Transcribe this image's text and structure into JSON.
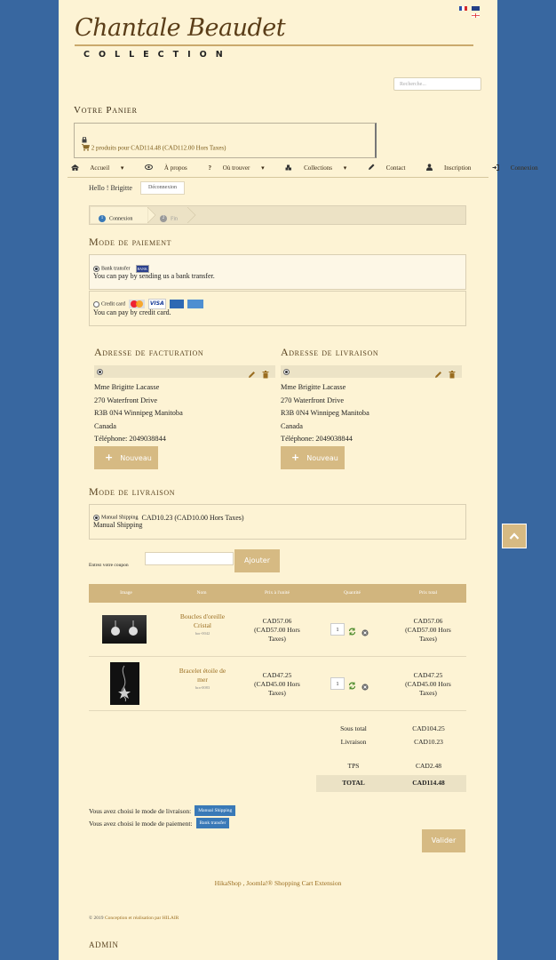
{
  "header": {
    "logo_main": "Chantale Beaudet",
    "logo_sub": "COLLECTION",
    "search_placeholder": "Recherche..."
  },
  "cart": {
    "title": "Votre Panier",
    "summary_prefix": "2 produits pour ",
    "summary_value": "CAD114.48 (CAD112.00 Hors Taxes)"
  },
  "nav": {
    "items": [
      "Accueil",
      "À propos",
      "Où trouver",
      "Collections",
      "Contact",
      "Inscription",
      "Connexion"
    ]
  },
  "user": {
    "hello": "Hello ! Brigitte",
    "logout": "Déconnexion"
  },
  "steps": [
    {
      "num": "1",
      "label": "Connexion"
    },
    {
      "num": "2",
      "label": "Fin"
    }
  ],
  "payment": {
    "title": "Mode de paiement",
    "options": [
      {
        "label": "Bank transfer",
        "badge": "BANK",
        "desc": "You can pay by sending us a bank transfer.",
        "selected": true
      },
      {
        "label": "Credit card",
        "desc": "You can pay by credit card.",
        "selected": false
      }
    ]
  },
  "billing": {
    "title": "Adresse de facturation",
    "name": "Mme Brigitte Lacasse",
    "street": "270 Waterfront Drive",
    "city": "R3B 0N4 Winnipeg Manitoba",
    "country": "Canada",
    "phone": "Téléphone: 2049038844",
    "new_button": "Nouveau"
  },
  "shipping_address": {
    "title": "Adresse de livraison",
    "name": "Mme Brigitte Lacasse",
    "street": "270 Waterfront Drive",
    "city": "R3B 0N4 Winnipeg Manitoba",
    "country": "Canada",
    "phone": "Téléphone: 2049038844",
    "new_button": "Nouveau"
  },
  "delivery": {
    "title": "Mode de livraison",
    "option_label": "Manual Shipping",
    "option_price": "CAD10.23 (CAD10.00 Hors Taxes)",
    "option_desc": "Manual Shipping"
  },
  "coupon": {
    "label": "Entrez votre coupon",
    "button": "Ajouter"
  },
  "table": {
    "headers": [
      "Image",
      "Nom",
      "Prix à l'unité",
      "Quantité",
      "Prix total"
    ],
    "rows": [
      {
        "name_l1": "Boucles d'oreille",
        "name_l2": "Cristal",
        "code": "bor-0042",
        "unit_l1": "CAD57.06",
        "unit_l2": "(CAD57.00 Hors",
        "unit_l3": "Taxes)",
        "qty": "1",
        "total_l1": "CAD57.06",
        "total_l2": "(CAD57.00 Hors",
        "total_l3": "Taxes)"
      },
      {
        "name_l1": "Bracelet étoile de",
        "name_l2": "mer",
        "code": "bra-0083",
        "unit_l1": "CAD47.25",
        "unit_l2": "(CAD45.00 Hors",
        "unit_l3": "Taxes)",
        "qty": "1",
        "total_l1": "CAD47.25",
        "total_l2": "(CAD45.00 Hors",
        "total_l3": "Taxes)"
      }
    ]
  },
  "totals": {
    "subtotal_label": "Sous total",
    "subtotal": "CAD104.25",
    "shipping_label": "Livraison",
    "shipping": "CAD10.23",
    "tax_label": "TPS",
    "tax": "CAD2.48",
    "total_label": "TOTAL",
    "total": "CAD114.48"
  },
  "recap": {
    "shipping_text": "Vous avez choisi le mode de livraison:",
    "shipping_badge": "Manual Shipping",
    "payment_text": "Vous avez choisi le mode de paiement:",
    "payment_badge": "Bank transfer"
  },
  "actions": {
    "validate": "Valider"
  },
  "footer": {
    "credit": "HikaShop , Joomla!® Shopping Cart Extension",
    "copyright": "© 2019 ",
    "copyright_link": "Conception et réalisation par HILAIR",
    "admin": "ADMIN"
  },
  "colors": {
    "accent": "#d6ba83",
    "page_bg": "#fdf3d4",
    "outer_bg": "#3867a0",
    "badge": "#3979b7"
  }
}
